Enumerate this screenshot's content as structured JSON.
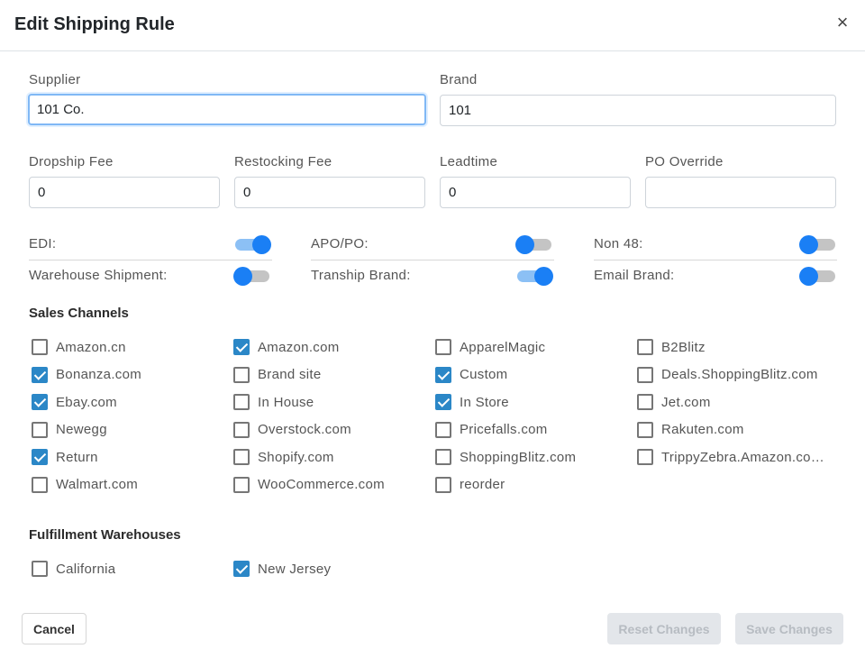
{
  "dialog": {
    "title": "Edit Shipping Rule",
    "close_icon": "×"
  },
  "fields": {
    "supplier": {
      "label": "Supplier",
      "value": "101 Co."
    },
    "brand": {
      "label": "Brand",
      "value": "101"
    },
    "dropship_fee": {
      "label": "Dropship Fee",
      "value": "0"
    },
    "restocking_fee": {
      "label": "Restocking Fee",
      "value": "0"
    },
    "leadtime": {
      "label": "Leadtime",
      "value": "0"
    },
    "po_override": {
      "label": "PO Override",
      "value": ""
    }
  },
  "toggles": [
    {
      "label": "EDI:",
      "on": true
    },
    {
      "label": "APO/PO:",
      "on": false
    },
    {
      "label": "Non 48:",
      "on": false
    },
    {
      "label": "Warehouse Shipment:",
      "on": false
    },
    {
      "label": "Tranship Brand:",
      "on": true
    },
    {
      "label": "Email Brand:",
      "on": false
    }
  ],
  "sales_channels": {
    "title": "Sales Channels",
    "items": [
      {
        "label": "Amazon.cn",
        "checked": false
      },
      {
        "label": "Amazon.com",
        "checked": true
      },
      {
        "label": "ApparelMagic",
        "checked": false
      },
      {
        "label": "B2Blitz",
        "checked": false
      },
      {
        "label": "Bonanza.com",
        "checked": true
      },
      {
        "label": "Brand site",
        "checked": false
      },
      {
        "label": "Custom",
        "checked": true
      },
      {
        "label": "Deals.ShoppingBlitz.com",
        "checked": false
      },
      {
        "label": "Ebay.com",
        "checked": true
      },
      {
        "label": "In House",
        "checked": false
      },
      {
        "label": "In Store",
        "checked": true
      },
      {
        "label": "Jet.com",
        "checked": false
      },
      {
        "label": "Newegg",
        "checked": false
      },
      {
        "label": "Overstock.com",
        "checked": false
      },
      {
        "label": "Pricefalls.com",
        "checked": false
      },
      {
        "label": "Rakuten.com",
        "checked": false
      },
      {
        "label": "Return",
        "checked": true
      },
      {
        "label": "Shopify.com",
        "checked": false
      },
      {
        "label": "ShoppingBlitz.com",
        "checked": false
      },
      {
        "label": "TrippyZebra.Amazon.co…",
        "checked": false
      },
      {
        "label": "Walmart.com",
        "checked": false
      },
      {
        "label": "WooCommerce.com",
        "checked": false
      },
      {
        "label": "reorder",
        "checked": false
      }
    ]
  },
  "fulfillment": {
    "title": "Fulfillment Warehouses",
    "items": [
      {
        "label": "California",
        "checked": false
      },
      {
        "label": "New Jersey",
        "checked": true
      }
    ]
  },
  "footer": {
    "cancel_label": "Cancel",
    "reset_label": "Reset Changes",
    "save_label": "Save Changes"
  },
  "colors": {
    "accent": "#1a7ff5",
    "checkbox_checked": "#2b87c7",
    "disabled_button": "#e3e6ea"
  }
}
